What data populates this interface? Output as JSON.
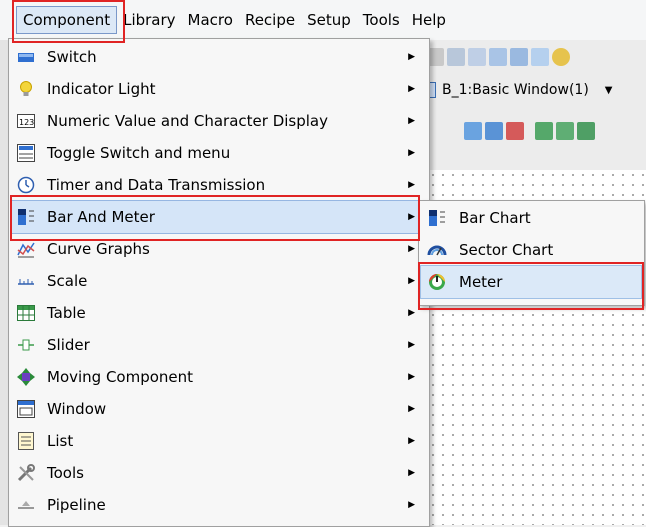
{
  "menubar": {
    "items": [
      "Component",
      "Library",
      "Macro",
      "Recipe",
      "Setup",
      "Tools",
      "Help"
    ]
  },
  "window_selector": {
    "value": "B_1:Basic Window(1)"
  },
  "component_menu": {
    "items": [
      {
        "label": "Switch",
        "icon": "switch-icon"
      },
      {
        "label": "Indicator Light",
        "icon": "bulb-icon"
      },
      {
        "label": "Numeric Value and Character Display",
        "icon": "numeric-123-icon"
      },
      {
        "label": "Toggle Switch and menu",
        "icon": "toggle-menu-icon"
      },
      {
        "label": "Timer and Data Transmission",
        "icon": "clock-icon"
      },
      {
        "label": "Bar And Meter",
        "icon": "bar-meter-icon"
      },
      {
        "label": "Curve Graphs",
        "icon": "curve-graph-icon"
      },
      {
        "label": "Scale",
        "icon": "scale-icon"
      },
      {
        "label": "Table",
        "icon": "table-icon"
      },
      {
        "label": "Slider",
        "icon": "slider-icon"
      },
      {
        "label": "Moving Component",
        "icon": "move-arrows-icon"
      },
      {
        "label": "Window",
        "icon": "window-icon"
      },
      {
        "label": "List",
        "icon": "list-icon"
      },
      {
        "label": "Tools",
        "icon": "tools-icon"
      },
      {
        "label": "Pipeline",
        "icon": "pipeline-icon"
      }
    ]
  },
  "bar_meter_submenu": {
    "items": [
      {
        "label": "Bar Chart",
        "icon": "bar-chart-icon"
      },
      {
        "label": "Sector Chart",
        "icon": "sector-chart-icon"
      },
      {
        "label": "Meter",
        "icon": "meter-icon"
      }
    ]
  },
  "colors": {
    "annotation": "#e02424",
    "highlight": "#d5e5f8"
  }
}
